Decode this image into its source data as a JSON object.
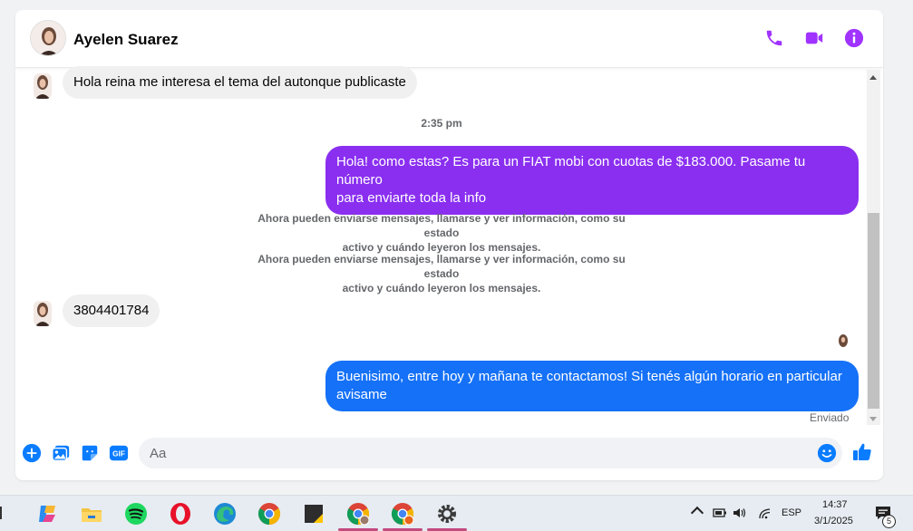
{
  "contact": {
    "name": "Ayelen Suarez"
  },
  "colors": {
    "accent": "#a033ff",
    "messenger_purple": "#8a2ff0",
    "messenger_blue": "#0a7cff",
    "incoming_bg": "#f0f0f0"
  },
  "messages": [
    {
      "direction": "incoming",
      "text": "Hola reina me interesa el tema del autonque publicaste"
    },
    {
      "direction": "outgoing",
      "text_line1": "Hola! como estas? Es para un FIAT mobi con cuotas de $183.000. Pasame tu número",
      "text_line2": "para enviarte toda la info"
    },
    {
      "direction": "incoming",
      "text": "3804401784"
    },
    {
      "direction": "outgoing",
      "text_line1": "Buenisimo, entre hoy y mañana te contactamos! Si tenés algún horario en particular",
      "text_line2": "avisame"
    }
  ],
  "timestamp": "2:35 pm",
  "system_messages": [
    {
      "line1": "Ahora pueden enviarse mensajes, llamarse y ver información, como su estado",
      "line2": "activo y cuándo leyeron los mensajes."
    },
    {
      "line1": "Ahora pueden enviarse mensajes, llamarse y ver información, como su estado",
      "line2": "activo y cuándo leyeron los mensajes."
    }
  ],
  "status": {
    "sent": "Enviado"
  },
  "composer": {
    "placeholder": "Aa"
  },
  "icons": {
    "header": [
      "phone-icon",
      "video-icon",
      "info-icon"
    ],
    "composer": [
      "plus-icon",
      "image-icon",
      "sticker-icon",
      "gif-icon",
      "emoji-icon",
      "like-icon"
    ]
  },
  "composer_gif": "GIF",
  "taskbar": {
    "apps": [
      "copilot",
      "file-explorer",
      "spotify",
      "opera",
      "edge",
      "chrome",
      "sticky-notes",
      "chrome-profile-1",
      "chrome-profile-2",
      "settings"
    ],
    "language": "ESP",
    "time": "14:37",
    "date": "3/1/2025",
    "notifications": "5"
  }
}
